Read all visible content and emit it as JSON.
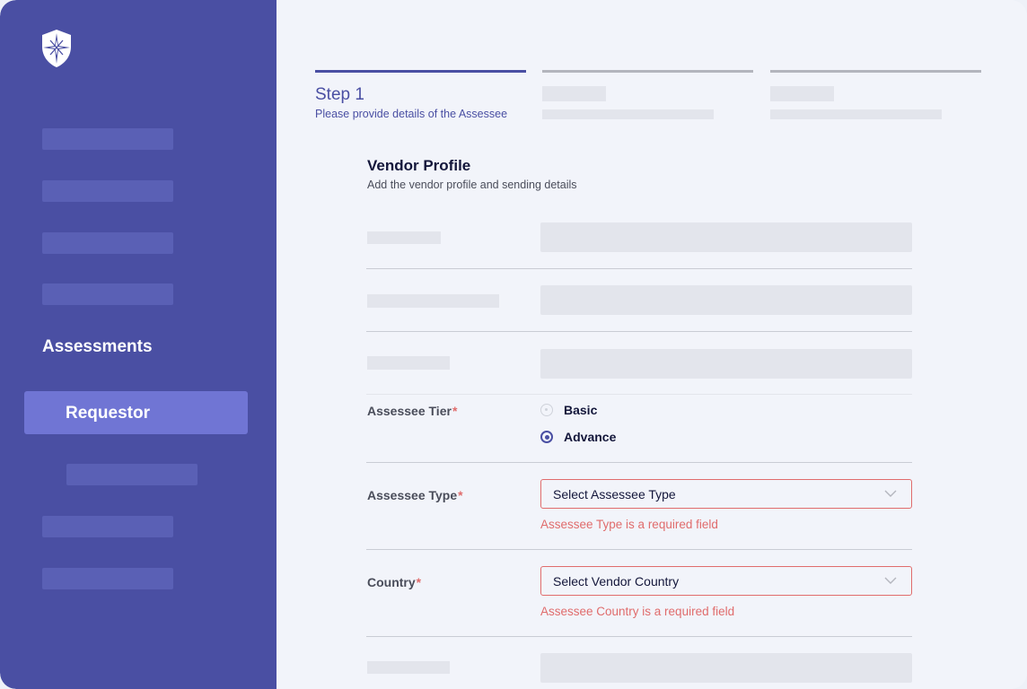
{
  "sidebar": {
    "logo_icon": "shield-compass-icon",
    "section_heading": "Assessments",
    "active_item_label": "Requestor",
    "accent_color": "#4a4fa3"
  },
  "stepper": {
    "active_step": {
      "title": "Step 1",
      "subtitle": "Please provide details of the Assessee"
    }
  },
  "form": {
    "title": "Vendor Profile",
    "subtitle": "Add the vendor profile and sending details",
    "tier": {
      "label": "Assessee Tier",
      "required_mark": "*",
      "options": [
        {
          "label": "Basic",
          "selected": false
        },
        {
          "label": "Advance",
          "selected": true
        }
      ]
    },
    "type": {
      "label": "Assessee Type",
      "required_mark": "*",
      "placeholder": "Select Assessee Type",
      "error": "Assessee Type is a required field"
    },
    "country": {
      "label": "Country",
      "required_mark": "*",
      "placeholder": "Select Vendor Country",
      "error": "Assessee Country is a required field"
    },
    "error_color": "#e06c6c"
  }
}
